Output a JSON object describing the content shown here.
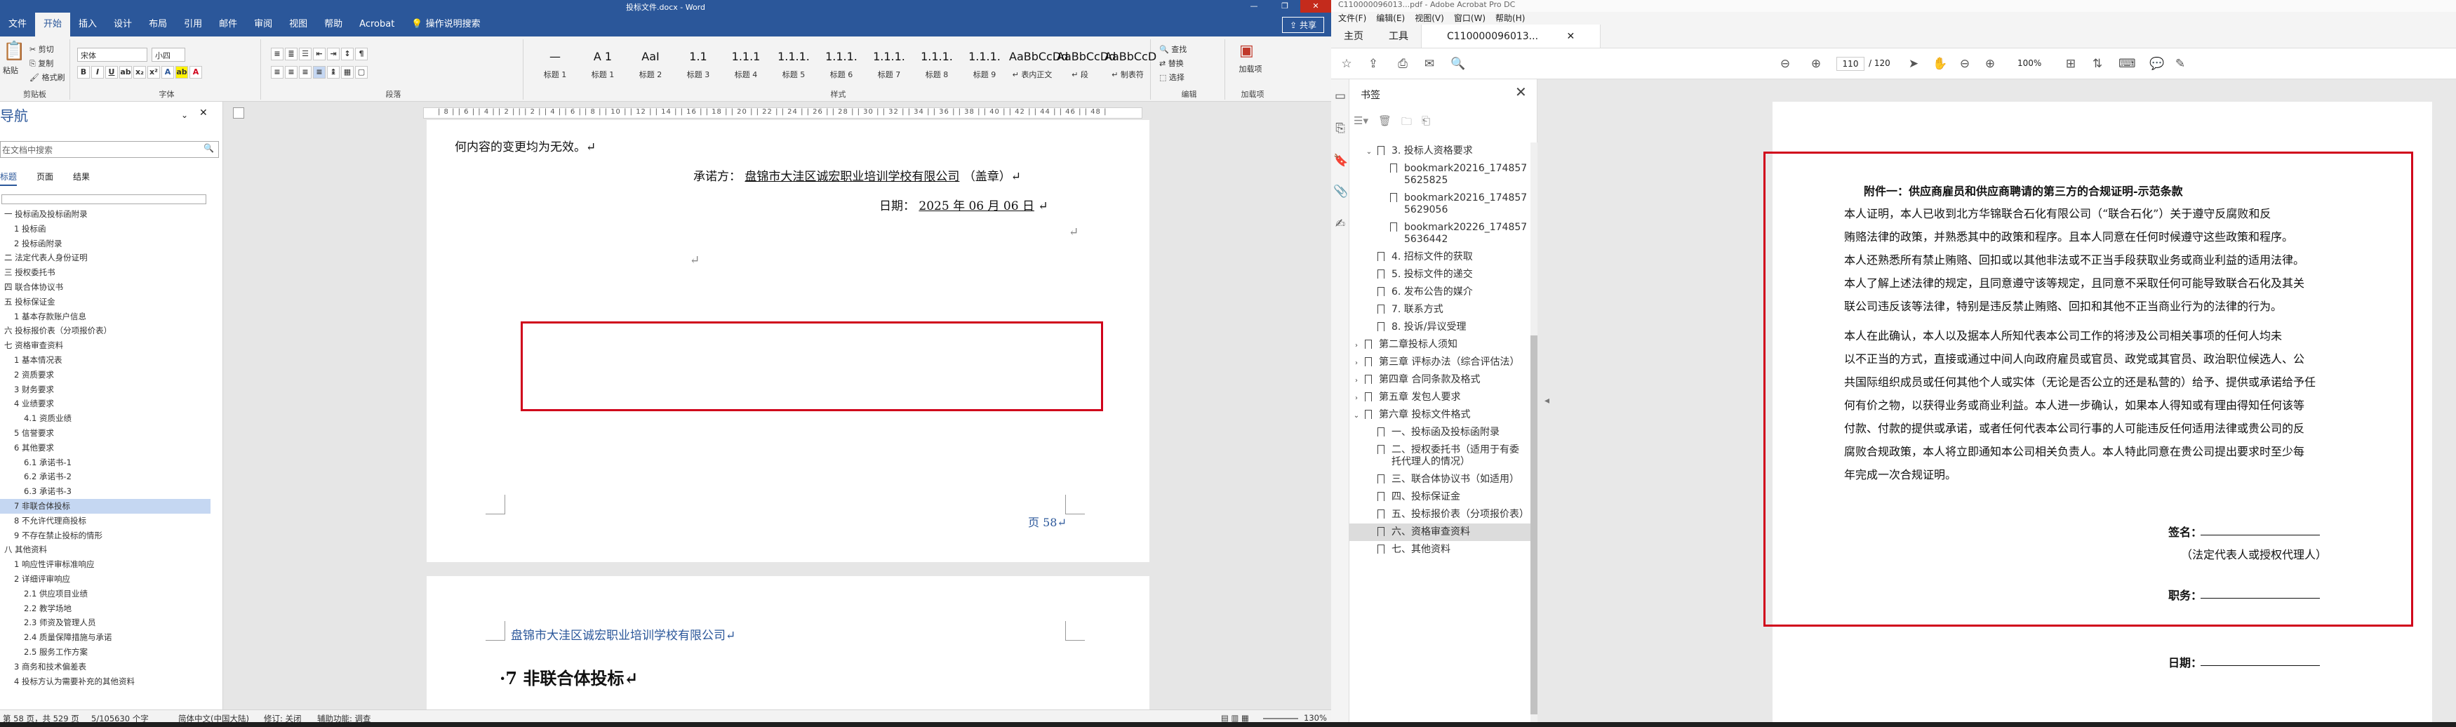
{
  "word": {
    "title": "投标文件.docx - Word",
    "window_buttons": [
      "—",
      "❐",
      "✕"
    ],
    "menu_tabs": [
      "文件",
      "开始",
      "插入",
      "设计",
      "布局",
      "引用",
      "邮件",
      "审阅",
      "视图",
      "帮助",
      "Acrobat",
      "操作说明搜索"
    ],
    "active_tab": "开始",
    "share_label": "共享",
    "ribbon": {
      "clipboard": {
        "paste": "粘贴",
        "cut": "剪切",
        "copy": "复制",
        "format_painter": "格式刷",
        "label": "剪贴板"
      },
      "font": {
        "name": "宋体",
        "size": "小四",
        "label": "字体"
      },
      "paragraph_label": "段落",
      "styles_label": "样式",
      "styles": [
        {
          "preview": "—",
          "name": "标题 1"
        },
        {
          "preview": "A 1",
          "name": "标题 1"
        },
        {
          "preview": "AaI",
          "name": "标题 2"
        },
        {
          "preview": "1.1",
          "name": "标题 3"
        },
        {
          "preview": "1.1.1",
          "name": "标题 4"
        },
        {
          "preview": "1.1.1.",
          "name": "标题 5"
        },
        {
          "preview": "1.1.1.",
          "name": "标题 6"
        },
        {
          "preview": "1.1.1.",
          "name": "标题 7"
        },
        {
          "preview": "1.1.1.",
          "name": "标题 8"
        },
        {
          "preview": "1.1.1.",
          "name": "标题 9"
        },
        {
          "preview": "AaBbCcDd",
          "name": "↵ 表内正文"
        },
        {
          "preview": "AaBbCcDd",
          "name": "↵ 段"
        },
        {
          "preview": "AaBbCcD",
          "name": "↵ 制表符"
        }
      ],
      "editing": {
        "find": "查找",
        "replace": "替换",
        "select": "选择",
        "label": "编辑"
      },
      "pdf": {
        "button": "加载项",
        "label": "加载项"
      }
    },
    "nav": {
      "title": "导航",
      "search_placeholder": "在文档中搜索",
      "tabs": [
        "标题",
        "页面",
        "结果"
      ],
      "items": [
        "一 投标函及投标函附录",
        "  1 投标函",
        "  2 投标函附录",
        "二 法定代表人身份证明",
        "三 授权委托书",
        "四 联合体协议书",
        "五 投标保证金",
        "  1 基本存款账户信息",
        "六 投标报价表（分项报价表）",
        "七 资格审查资料",
        "  1 基本情况表",
        "  2 资质要求",
        "  3 财务要求",
        "  4 业绩要求",
        "    4.1 资质业绩",
        "  5 信誉要求",
        "  6 其他要求",
        "    6.1 承诺书-1",
        "    6.2 承诺书-2",
        "    6.3 承诺书-3",
        "  7 非联合体投标",
        "  8 不允许代理商投标",
        "  9 不存在禁止投标的情形",
        "八 其他资料",
        "  1 响应性评审标准响应",
        "  2 详细评审响应",
        "    2.1 供应项目业绩",
        "    2.2 教学场地",
        "    2.3 师资及管理人员",
        "    2.4 质量保障措施与承诺",
        "    2.5 服务工作方案",
        "  3 商务和技术偏差表",
        "  4 投标方认为需要补充的其他资料"
      ],
      "selected_index": 20
    },
    "ruler_text": "| 8 | | 6 | | 4 | | 2 | | | 2 | | 4 | | 6 | | 8 | | 10 | | 12 | | 14 | | 16 | | 18 | | 20 | | 22 | | 24 | | 26 | | 28 | | 30 | | 32 | | 34 | | 36 | | 38 | | 40 | | 42 | | 44 | | 46 | | 48 |",
    "page1": {
      "top_line": "何内容的变更均为无效。↵",
      "promisor_label": "承诺方：",
      "promisor": "盘锦市大洼区诚宏职业培训学校有限公司",
      "seal": "（盖章）↵",
      "date_label": "日期：",
      "date": "2025 年 06 月 06 日",
      "page_number": "页 58↵"
    },
    "page2": {
      "header": "盘锦市大洼区诚宏职业培训学校有限公司↵",
      "heading": "·7  非联合体投标↵"
    },
    "status": {
      "page": "第 58 页，共 529 页",
      "words": "5/105630 个字",
      "language": "简体中文(中国大陆)",
      "track": "修订: 关闭",
      "accessibility": "辅助功能: 调查",
      "zoom": "130%"
    }
  },
  "acrobat": {
    "title": "C110000096013...pdf - Adobe Acrobat Pro DC",
    "menu": [
      "文件(F)",
      "编辑(E)",
      "视图(V)",
      "窗口(W)",
      "帮助(H)"
    ],
    "tabs": [
      "主页",
      "工具",
      "C110000096013..."
    ],
    "page_current": "110",
    "page_total": "/ 120",
    "zoom": "100%",
    "bookmarks_title": "书签",
    "bookmarks": [
      {
        "level": 1,
        "text": "3. 投标人资格要求",
        "twisty": "⌄"
      },
      {
        "level": 2,
        "text": "bookmark20216_1748575625825"
      },
      {
        "level": 2,
        "text": "bookmark20216_1748575629056"
      },
      {
        "level": 2,
        "text": "bookmark20226_1748575636442"
      },
      {
        "level": 1,
        "text": "4. 招标文件的获取"
      },
      {
        "level": 1,
        "text": "5. 投标文件的递交"
      },
      {
        "level": 1,
        "text": "6. 发布公告的媒介"
      },
      {
        "level": 1,
        "text": "7. 联系方式"
      },
      {
        "level": 1,
        "text": "8. 投诉/异议受理"
      },
      {
        "level": 0,
        "text": "第二章投标人须知",
        "twisty": "›"
      },
      {
        "level": 0,
        "text": "第三章 评标办法（综合评估法）",
        "twisty": "›"
      },
      {
        "level": 0,
        "text": "第四章 合同条款及格式",
        "twisty": "›"
      },
      {
        "level": 0,
        "text": "第五章 发包人要求",
        "twisty": "›"
      },
      {
        "level": 0,
        "text": "第六章 投标文件格式",
        "twisty": "⌄"
      },
      {
        "level": 1,
        "text": "一、投标函及投标函附录"
      },
      {
        "level": 1,
        "text": "二、授权委托书（适用于有委托代理人的情况）"
      },
      {
        "level": 1,
        "text": "三、联合体协议书（如适用）"
      },
      {
        "level": 1,
        "text": "四、投标保证金"
      },
      {
        "level": 1,
        "text": "五、投标报价表（分项报价表）"
      },
      {
        "level": 1,
        "text": "六、资格审查资料",
        "selected": true
      },
      {
        "level": 1,
        "text": "七、其他资料"
      }
    ],
    "page": {
      "attachment_title": "附件一：供应商雇员和供应商聘请的第三方的合规证明-示范条款",
      "para1": [
        "本人证明，本人已收到北方华锦联合石化有限公司（“联合石化”）关于遵守反腐败和反",
        "贿赂法律的政策，并熟悉其中的政策和程序。且本人同意在任何时候遵守这些政策和程序。",
        "本人还熟悉所有禁止贿赂、回扣或以其他非法或不正当手段获取业务或商业利益的适用法律。",
        "本人了解上述法律的规定，且同意遵守该等规定，且同意不采取任何可能导致联合石化及其关",
        "联公司违反该等法律，特别是违反禁止贿赂、回扣和其他不正当商业行为的法律的行为。"
      ],
      "para2": [
        "本人在此确认，本人以及据本人所知代表本公司工作的将涉及公司相关事项的任何人均未",
        "以不正当的方式，直接或通过中间人向政府雇员或官员、政党或其官员、政治职位候选人、公",
        "共国际组织成员或任何其他个人或实体（无论是否公立的还是私营的）给予、提供或承诺给予任",
        "何有价之物，以获得业务或商业利益。本人进一步确认，如果本人得知或有理由得知任何该等",
        "付款、付款的提供或承诺，或者任何代表本公司行事的人可能违反任何适用法律或贵公司的反",
        "腐败合规政策，本人将立即通知本公司相关负责人。本人特此同意在贵公司提出要求时至少每",
        "年完成一次合规证明。"
      ],
      "sign_label": "签名：",
      "sign_sub": "（法定代表人或授权代理人）",
      "position_label": "职务：",
      "date_label": "日期："
    }
  }
}
